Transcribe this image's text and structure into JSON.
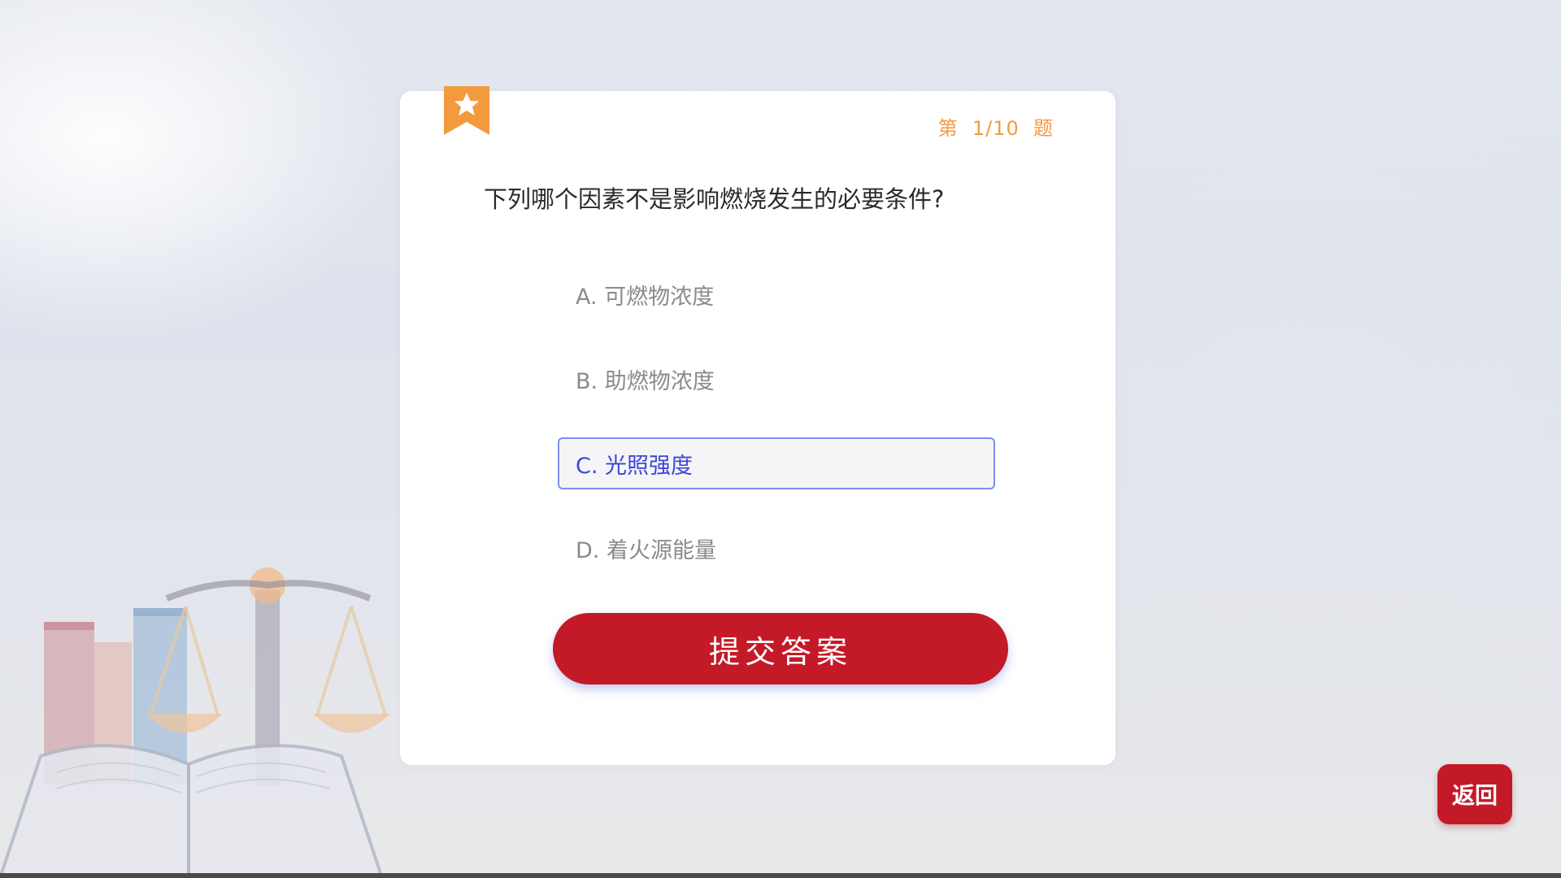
{
  "quiz": {
    "counter": "第  1/10  题",
    "question": "下列哪个因素不是影响燃烧发生的必要条件?",
    "options": [
      {
        "label": "A. 可燃物浓度",
        "selected": false
      },
      {
        "label": "B. 助燃物浓度",
        "selected": false
      },
      {
        "label": "C. 光照强度",
        "selected": true
      },
      {
        "label": "D. 着火源能量",
        "selected": false
      }
    ],
    "submit_label": "提交答案"
  },
  "nav": {
    "back_label": "返回"
  },
  "colors": {
    "primary": "#c41a28",
    "accent": "#f39a3f",
    "selected_text": "#3b46d9",
    "selected_border": "#7b8ff0"
  },
  "icons": {
    "bookmark": "bookmark-star-icon",
    "decor": "justice-scale-books-icon"
  }
}
